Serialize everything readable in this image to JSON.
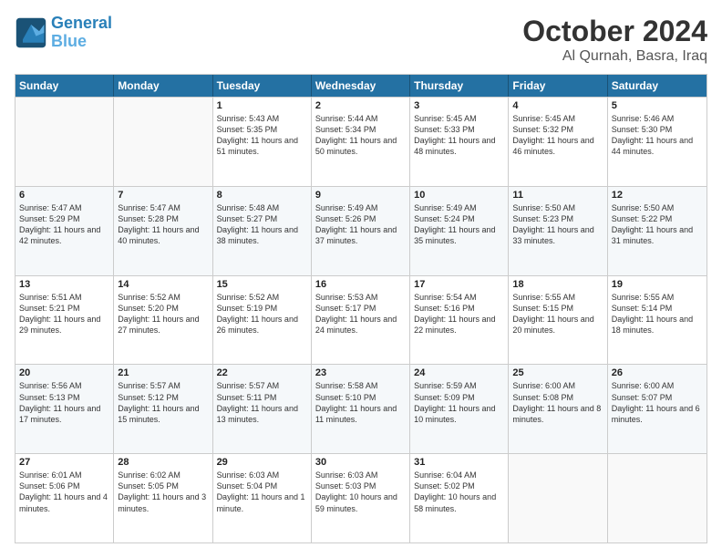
{
  "header": {
    "logo_line1": "General",
    "logo_line2": "Blue",
    "month": "October 2024",
    "location": "Al Qurnah, Basra, Iraq"
  },
  "days_of_week": [
    "Sunday",
    "Monday",
    "Tuesday",
    "Wednesday",
    "Thursday",
    "Friday",
    "Saturday"
  ],
  "weeks": [
    [
      {
        "day": "",
        "empty": true
      },
      {
        "day": "",
        "empty": true
      },
      {
        "day": "1",
        "sunrise": "5:43 AM",
        "sunset": "5:35 PM",
        "daylight": "11 hours and 51 minutes."
      },
      {
        "day": "2",
        "sunrise": "5:44 AM",
        "sunset": "5:34 PM",
        "daylight": "11 hours and 50 minutes."
      },
      {
        "day": "3",
        "sunrise": "5:45 AM",
        "sunset": "5:33 PM",
        "daylight": "11 hours and 48 minutes."
      },
      {
        "day": "4",
        "sunrise": "5:45 AM",
        "sunset": "5:32 PM",
        "daylight": "11 hours and 46 minutes."
      },
      {
        "day": "5",
        "sunrise": "5:46 AM",
        "sunset": "5:30 PM",
        "daylight": "11 hours and 44 minutes."
      }
    ],
    [
      {
        "day": "6",
        "sunrise": "5:47 AM",
        "sunset": "5:29 PM",
        "daylight": "11 hours and 42 minutes."
      },
      {
        "day": "7",
        "sunrise": "5:47 AM",
        "sunset": "5:28 PM",
        "daylight": "11 hours and 40 minutes."
      },
      {
        "day": "8",
        "sunrise": "5:48 AM",
        "sunset": "5:27 PM",
        "daylight": "11 hours and 38 minutes."
      },
      {
        "day": "9",
        "sunrise": "5:49 AM",
        "sunset": "5:26 PM",
        "daylight": "11 hours and 37 minutes."
      },
      {
        "day": "10",
        "sunrise": "5:49 AM",
        "sunset": "5:24 PM",
        "daylight": "11 hours and 35 minutes."
      },
      {
        "day": "11",
        "sunrise": "5:50 AM",
        "sunset": "5:23 PM",
        "daylight": "11 hours and 33 minutes."
      },
      {
        "day": "12",
        "sunrise": "5:50 AM",
        "sunset": "5:22 PM",
        "daylight": "11 hours and 31 minutes."
      }
    ],
    [
      {
        "day": "13",
        "sunrise": "5:51 AM",
        "sunset": "5:21 PM",
        "daylight": "11 hours and 29 minutes."
      },
      {
        "day": "14",
        "sunrise": "5:52 AM",
        "sunset": "5:20 PM",
        "daylight": "11 hours and 27 minutes."
      },
      {
        "day": "15",
        "sunrise": "5:52 AM",
        "sunset": "5:19 PM",
        "daylight": "11 hours and 26 minutes."
      },
      {
        "day": "16",
        "sunrise": "5:53 AM",
        "sunset": "5:17 PM",
        "daylight": "11 hours and 24 minutes."
      },
      {
        "day": "17",
        "sunrise": "5:54 AM",
        "sunset": "5:16 PM",
        "daylight": "11 hours and 22 minutes."
      },
      {
        "day": "18",
        "sunrise": "5:55 AM",
        "sunset": "5:15 PM",
        "daylight": "11 hours and 20 minutes."
      },
      {
        "day": "19",
        "sunrise": "5:55 AM",
        "sunset": "5:14 PM",
        "daylight": "11 hours and 18 minutes."
      }
    ],
    [
      {
        "day": "20",
        "sunrise": "5:56 AM",
        "sunset": "5:13 PM",
        "daylight": "11 hours and 17 minutes."
      },
      {
        "day": "21",
        "sunrise": "5:57 AM",
        "sunset": "5:12 PM",
        "daylight": "11 hours and 15 minutes."
      },
      {
        "day": "22",
        "sunrise": "5:57 AM",
        "sunset": "5:11 PM",
        "daylight": "11 hours and 13 minutes."
      },
      {
        "day": "23",
        "sunrise": "5:58 AM",
        "sunset": "5:10 PM",
        "daylight": "11 hours and 11 minutes."
      },
      {
        "day": "24",
        "sunrise": "5:59 AM",
        "sunset": "5:09 PM",
        "daylight": "11 hours and 10 minutes."
      },
      {
        "day": "25",
        "sunrise": "6:00 AM",
        "sunset": "5:08 PM",
        "daylight": "11 hours and 8 minutes."
      },
      {
        "day": "26",
        "sunrise": "6:00 AM",
        "sunset": "5:07 PM",
        "daylight": "11 hours and 6 minutes."
      }
    ],
    [
      {
        "day": "27",
        "sunrise": "6:01 AM",
        "sunset": "5:06 PM",
        "daylight": "11 hours and 4 minutes."
      },
      {
        "day": "28",
        "sunrise": "6:02 AM",
        "sunset": "5:05 PM",
        "daylight": "11 hours and 3 minutes."
      },
      {
        "day": "29",
        "sunrise": "6:03 AM",
        "sunset": "5:04 PM",
        "daylight": "11 hours and 1 minute."
      },
      {
        "day": "30",
        "sunrise": "6:03 AM",
        "sunset": "5:03 PM",
        "daylight": "10 hours and 59 minutes."
      },
      {
        "day": "31",
        "sunrise": "6:04 AM",
        "sunset": "5:02 PM",
        "daylight": "10 hours and 58 minutes."
      },
      {
        "day": "",
        "empty": true
      },
      {
        "day": "",
        "empty": true
      }
    ]
  ]
}
